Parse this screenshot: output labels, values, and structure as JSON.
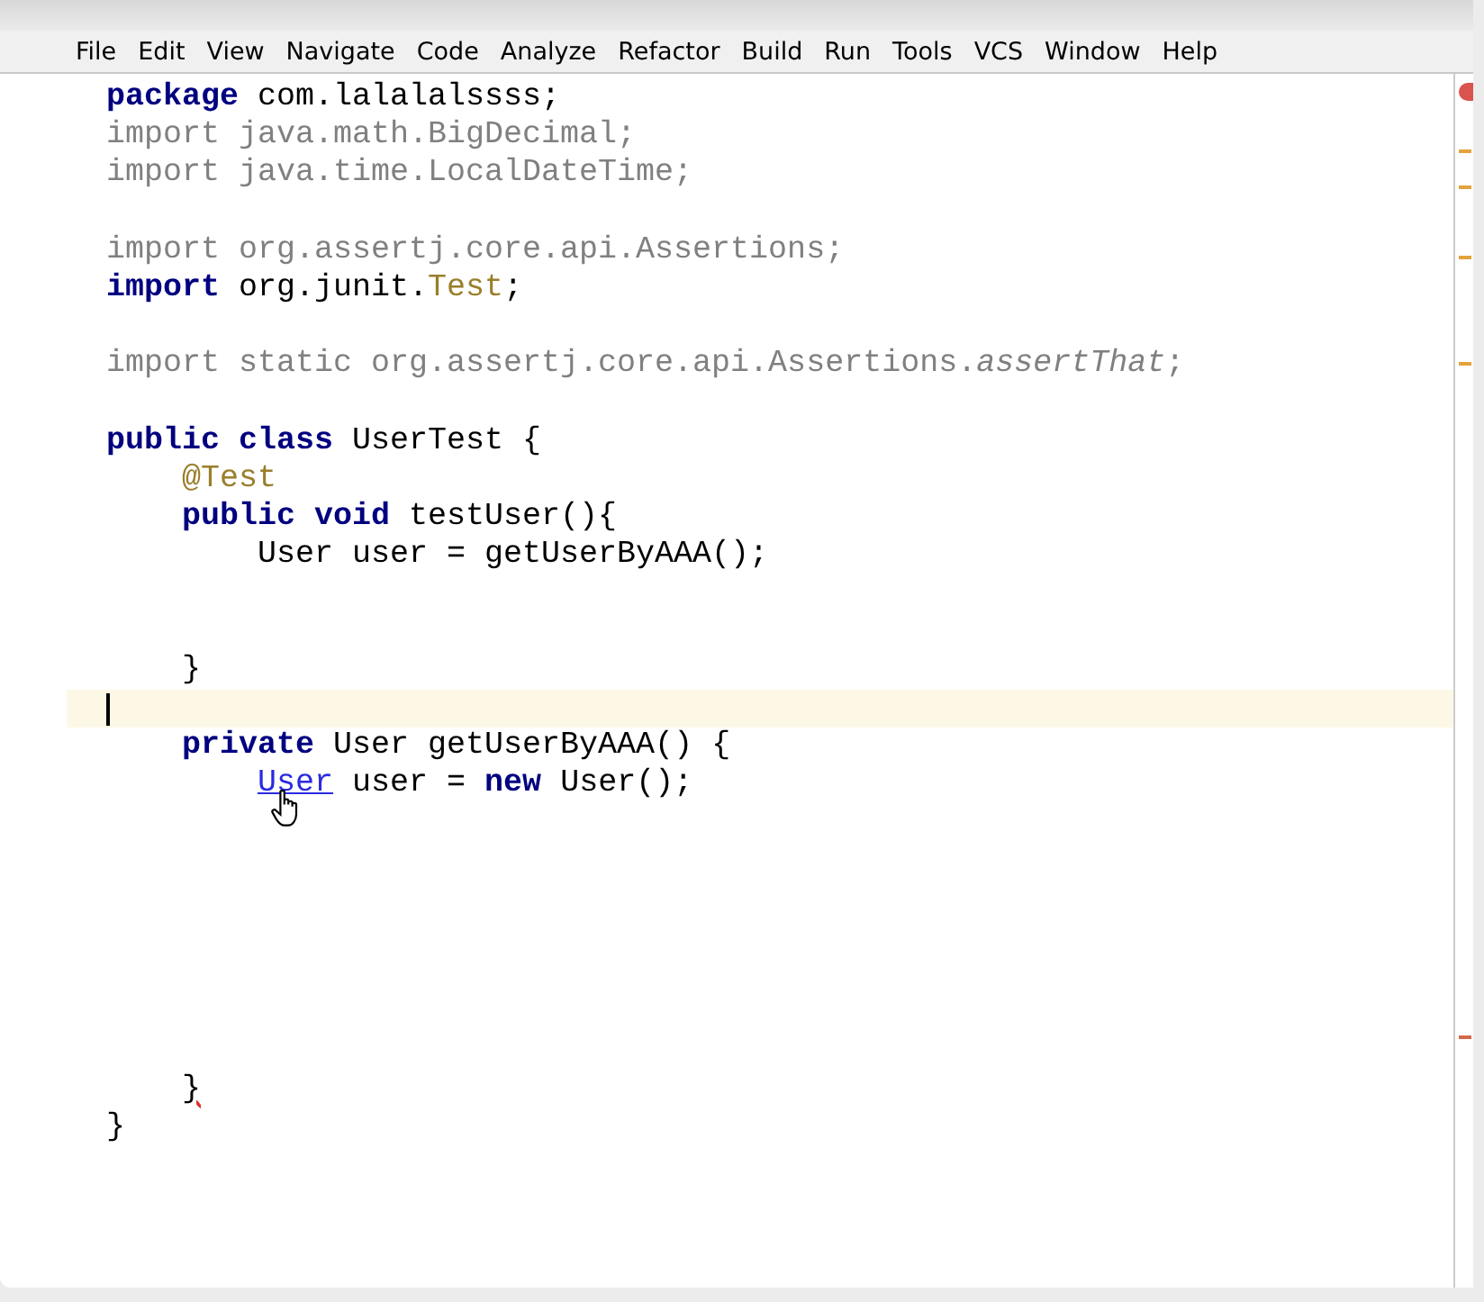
{
  "menu_bar": [
    {
      "label": "File"
    },
    {
      "label": "Edit"
    },
    {
      "label": "View"
    },
    {
      "label": "Navigate"
    },
    {
      "label": "Code"
    },
    {
      "label": "Analyze"
    },
    {
      "label": "Refactor"
    },
    {
      "label": "Build"
    },
    {
      "label": "Run"
    },
    {
      "label": "Tools"
    },
    {
      "label": "VCS"
    },
    {
      "label": "Window"
    },
    {
      "label": "Help"
    }
  ],
  "editor": {
    "lines": [
      {
        "current": false,
        "tokens": [
          {
            "text": "package",
            "kind": "keyword"
          },
          {
            "text": " com.lalalalssss;",
            "kind": "plain"
          }
        ]
      },
      {
        "current": false,
        "tokens": [
          {
            "text": "import java.math.BigDecimal;",
            "kind": "unused"
          }
        ]
      },
      {
        "current": false,
        "tokens": [
          {
            "text": "import java.time.LocalDateTime;",
            "kind": "unused"
          }
        ]
      },
      {
        "current": false
      },
      {
        "current": false,
        "tokens": [
          {
            "text": "import org.assertj.core.api.Assertions;",
            "kind": "unused"
          }
        ]
      },
      {
        "current": false,
        "tokens": [
          {
            "text": "import",
            "kind": "keyword"
          },
          {
            "text": " org.junit.",
            "kind": "plain"
          },
          {
            "text": "Test",
            "kind": "annotation"
          },
          {
            "text": ";",
            "kind": "plain"
          }
        ]
      },
      {
        "current": false
      },
      {
        "current": false,
        "tokens": [
          {
            "text": "import static org.assertj.core.api.Assertions.",
            "kind": "unused"
          },
          {
            "text": "assertThat",
            "kind": "unused-italic"
          },
          {
            "text": ";",
            "kind": "unused"
          }
        ]
      },
      {
        "current": false
      },
      {
        "current": false,
        "tokens": [
          {
            "text": "public class",
            "kind": "keyword"
          },
          {
            "text": " UserTest {",
            "kind": "plain"
          }
        ]
      },
      {
        "current": false,
        "tokens": [
          {
            "text": "    @Test",
            "kind": "annotation"
          }
        ]
      },
      {
        "current": false,
        "tokens": [
          {
            "text": "    public void",
            "kind": "keyword"
          },
          {
            "text": " testUser(){",
            "kind": "plain"
          }
        ]
      },
      {
        "current": false,
        "tokens": [
          {
            "text": "        User user = getUserByAAA();",
            "kind": "plain"
          }
        ]
      },
      {
        "current": false
      },
      {
        "current": false
      },
      {
        "current": false,
        "tokens": [
          {
            "text": "    }",
            "kind": "plain"
          }
        ]
      },
      {
        "current": true
      },
      {
        "current": false,
        "tokens": [
          {
            "text": "    private",
            "kind": "keyword"
          },
          {
            "text": " User getUserByAAA() {",
            "kind": "plain"
          }
        ]
      },
      {
        "current": false,
        "tokens": [
          {
            "text": "        User",
            "kind": "link"
          },
          {
            "text": " user = ",
            "kind": "plain"
          },
          {
            "text": "new",
            "kind": "keyword"
          },
          {
            "text": " User();",
            "kind": "plain"
          }
        ]
      },
      {
        "current": false
      },
      {
        "current": false
      },
      {
        "current": false
      },
      {
        "current": false
      },
      {
        "current": false
      },
      {
        "current": false
      },
      {
        "current": false
      },
      {
        "current": false,
        "tokens": [
          {
            "text": "    }",
            "kind": "error"
          }
        ]
      },
      {
        "current": false,
        "tokens": [
          {
            "text": "}",
            "kind": "plain"
          }
        ]
      }
    ]
  }
}
